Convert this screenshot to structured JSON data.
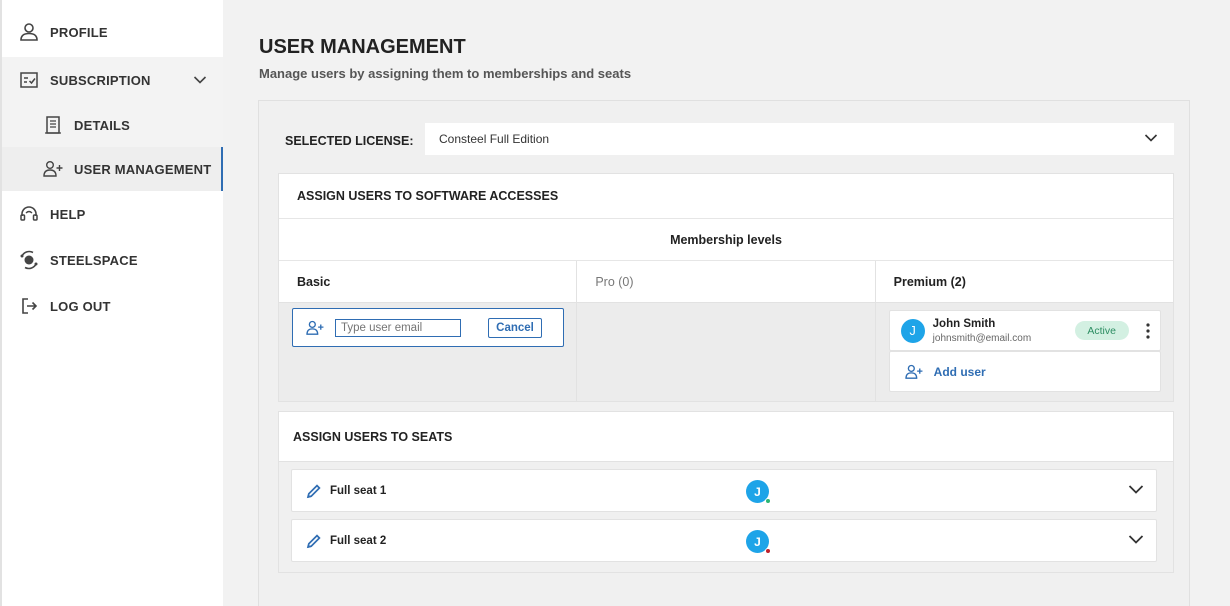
{
  "sidebar": {
    "items": [
      {
        "label": "PROFILE",
        "icon": "person-icon"
      },
      {
        "label": "SUBSCRIPTION",
        "icon": "subscription-icon"
      },
      {
        "label": "DETAILS",
        "icon": "document-icon"
      },
      {
        "label": "USER MANAGEMENT",
        "icon": "user-add-icon"
      },
      {
        "label": "HELP",
        "icon": "headset-icon"
      },
      {
        "label": "STEELSPACE",
        "icon": "steelspace-icon"
      },
      {
        "label": "LOG OUT",
        "icon": "logout-icon"
      }
    ]
  },
  "page": {
    "title": "USER MANAGEMENT",
    "subtitle": "Manage users by assigning them to memberships and seats"
  },
  "license": {
    "label": "SELECTED LICENSE:",
    "value": "Consteel Full Edition"
  },
  "access": {
    "title": "ASSIGN USERS TO SOFTWARE ACCESSES",
    "membership_header": "Membership levels",
    "columns": [
      "Basic",
      "Pro (0)",
      "Premium (2)"
    ],
    "email_placeholder": "Type user email",
    "cancel_label": "Cancel",
    "user": {
      "initial": "J",
      "name": "John Smith",
      "email": "johnsmith@email.com",
      "status": "Active"
    },
    "add_user_label": "Add user"
  },
  "seats": {
    "title": "ASSIGN USERS TO SEATS",
    "rows": [
      {
        "label": "Full seat 1",
        "initial": "J",
        "dot_color": "#2bb673"
      },
      {
        "label": "Full seat 2",
        "initial": "J",
        "dot_color": "#c0202a"
      }
    ]
  },
  "colors": {
    "accent": "#2f6db3",
    "avatar": "#1ea4e8",
    "active_badge": "#d3f0e2"
  }
}
